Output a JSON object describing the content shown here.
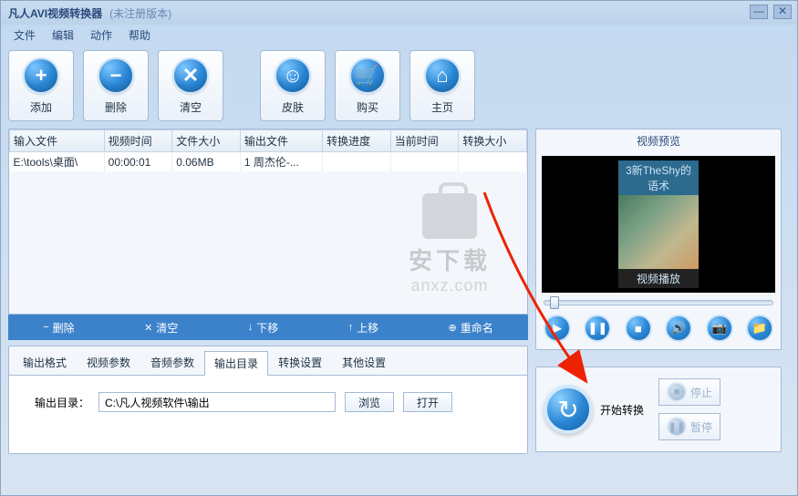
{
  "titlebar": {
    "title": "凡人AVI视频转换器",
    "subtitle": "(未注册版本)"
  },
  "menu": [
    "文件",
    "编辑",
    "动作",
    "帮助"
  ],
  "toolbar": [
    {
      "icon": "+",
      "label": "添加",
      "name": "add-button"
    },
    {
      "icon": "−",
      "label": "删除",
      "name": "delete-button"
    },
    {
      "icon": "✕",
      "label": "清空",
      "name": "clear-button"
    },
    {
      "icon": "☺",
      "label": "皮肤",
      "name": "skin-button"
    },
    {
      "icon": "🛒",
      "label": "购买",
      "name": "buy-button"
    },
    {
      "icon": "⌂",
      "label": "主页",
      "name": "home-button"
    }
  ],
  "table": {
    "headers": [
      "输入文件",
      "视频时间",
      "文件大小",
      "输出文件",
      "转换进度",
      "当前时间",
      "转换大小"
    ],
    "rows": [
      {
        "cells": [
          "E:\\tools\\桌面\\",
          "00:00:01",
          "0.06MB",
          "1 周杰伦-...",
          "",
          "",
          ""
        ]
      }
    ]
  },
  "watermark": {
    "line1": "安下载",
    "line2": "anxz.com"
  },
  "actions": [
    {
      "icon": "−",
      "label": "删除",
      "name": "action-delete"
    },
    {
      "icon": "✕",
      "label": "清空",
      "name": "action-clear"
    },
    {
      "icon": "↓",
      "label": "下移",
      "name": "action-move-down"
    },
    {
      "icon": "↑",
      "label": "上移",
      "name": "action-move-up"
    },
    {
      "icon": "⊕",
      "label": "重命名",
      "name": "action-rename"
    }
  ],
  "tabs": [
    "输出格式",
    "视频参数",
    "音频参数",
    "输出目录",
    "转换设置",
    "其他设置"
  ],
  "active_tab": 3,
  "output": {
    "label": "输出目录：",
    "value": "C:\\凡人视频软件\\输出",
    "browse": "浏览",
    "open": "打开"
  },
  "preview": {
    "title": "视频预览",
    "video_text_top": "3新TheShy的语术",
    "video_text_bot": "视频播放"
  },
  "media_buttons": [
    {
      "glyph": "▶",
      "name": "play-button"
    },
    {
      "glyph": "❚❚",
      "name": "pause-button"
    },
    {
      "glyph": "■",
      "name": "stop-button"
    },
    {
      "glyph": "🔊",
      "name": "volume-button"
    },
    {
      "glyph": "📷",
      "name": "snapshot-button"
    },
    {
      "glyph": "📁",
      "name": "folder-button"
    }
  ],
  "controls": {
    "start": "开始转换",
    "stop": "停止",
    "pause": "暂停"
  }
}
